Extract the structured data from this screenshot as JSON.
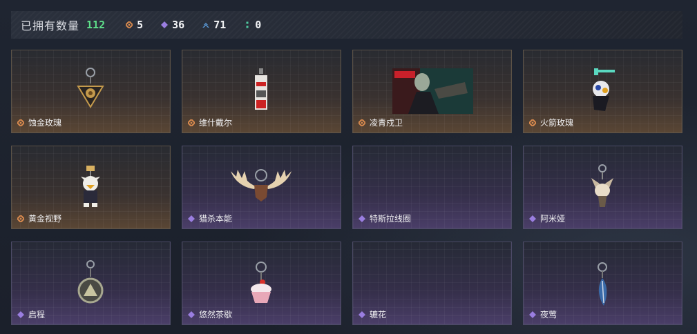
{
  "summary": {
    "label": "已拥有数量",
    "total": "112",
    "rarities": [
      {
        "name": "gold-rarity",
        "count": "5",
        "color": "#d98a4e"
      },
      {
        "name": "purple-rarity",
        "count": "36",
        "color": "#9a7ee0"
      },
      {
        "name": "blue-rarity",
        "count": "71",
        "color": "#5a9ad8"
      },
      {
        "name": "green-rarity",
        "count": "0",
        "color": "#4ec9a0"
      }
    ]
  },
  "items": [
    {
      "name": "蚀金玫瑰",
      "rarity": "gold",
      "icon": "gold-rose-charm"
    },
    {
      "name": "维什戴尔",
      "rarity": "gold",
      "icon": "tag-charm"
    },
    {
      "name": "凌青戍卫",
      "rarity": "gold",
      "icon": "character-poster"
    },
    {
      "name": "火箭玫瑰",
      "rarity": "gold",
      "icon": "rocket-charm"
    },
    {
      "name": "黄金视野",
      "rarity": "gold",
      "icon": "bird-figure-charm"
    },
    {
      "name": "猎杀本能",
      "rarity": "purple",
      "icon": "antler-charm"
    },
    {
      "name": "特斯拉线圈",
      "rarity": "purple",
      "icon": "empty"
    },
    {
      "name": "阿米娅",
      "rarity": "purple",
      "icon": "fox-charm"
    },
    {
      "name": "启程",
      "rarity": "purple",
      "icon": "emblem-charm"
    },
    {
      "name": "悠然茶歇",
      "rarity": "purple",
      "icon": "cupcake-charm"
    },
    {
      "name": "辘花",
      "rarity": "purple",
      "icon": "empty"
    },
    {
      "name": "夜莺",
      "rarity": "purple",
      "icon": "feather-charm"
    }
  ]
}
